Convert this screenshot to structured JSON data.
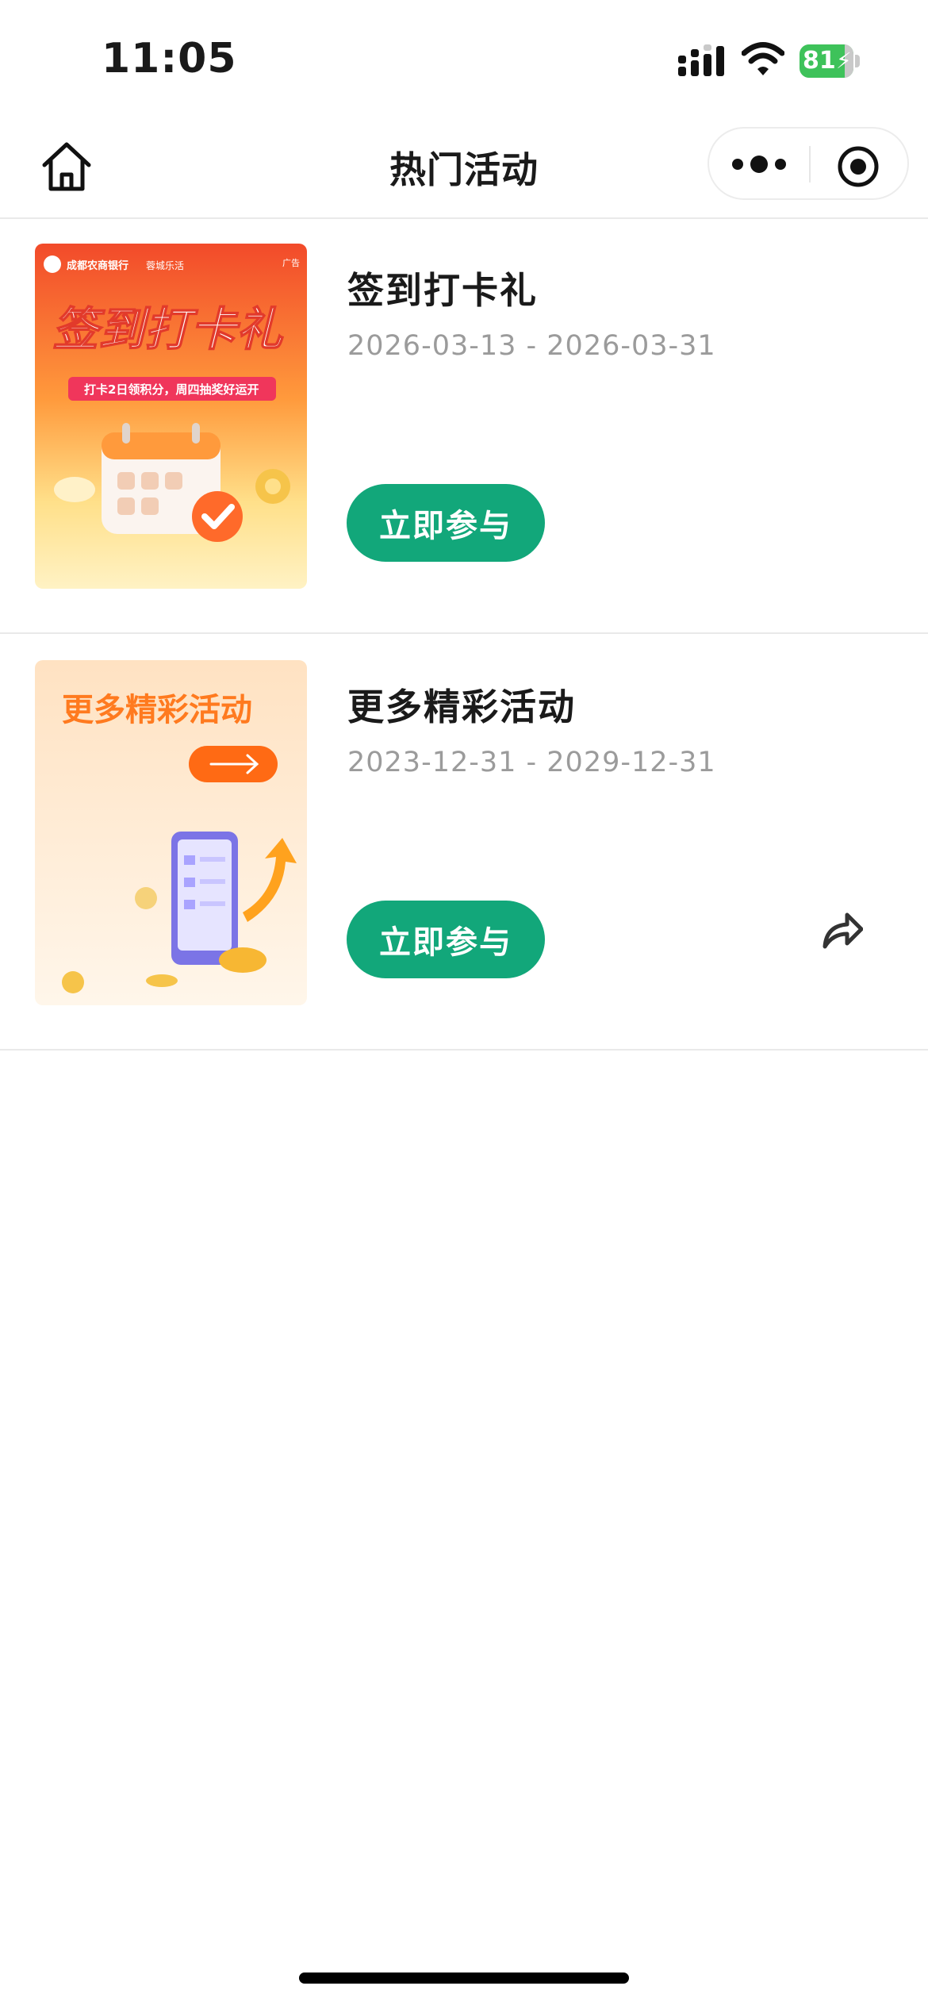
{
  "status_bar": {
    "time": "11:05",
    "battery_level": "81",
    "battery_charging": true
  },
  "nav": {
    "title": "热门活动",
    "home_icon": "home-icon",
    "more_icon": "more-dots-icon",
    "close_icon": "target-close-icon"
  },
  "items": [
    {
      "title": "签到打卡礼",
      "date_range": "2026-03-13 - 2026-03-31",
      "button_label": "立即参与",
      "banner": {
        "bank_name": "成都农商银行",
        "partner": "蓉城乐活",
        "ad_tag": "广告",
        "headline": "签到打卡礼",
        "ribbon": "打卡2日领积分，周四抽奖好运开"
      }
    },
    {
      "title": "更多精彩活动",
      "date_range": "2023-12-31 - 2029-12-31",
      "button_label": "立即参与",
      "banner": {
        "headline": "更多精彩活动"
      },
      "share_icon": "share-arrow-icon"
    }
  ],
  "colors": {
    "accent": "#12a77a",
    "battery": "#3ec25a",
    "date_text": "#9b9b9b"
  }
}
